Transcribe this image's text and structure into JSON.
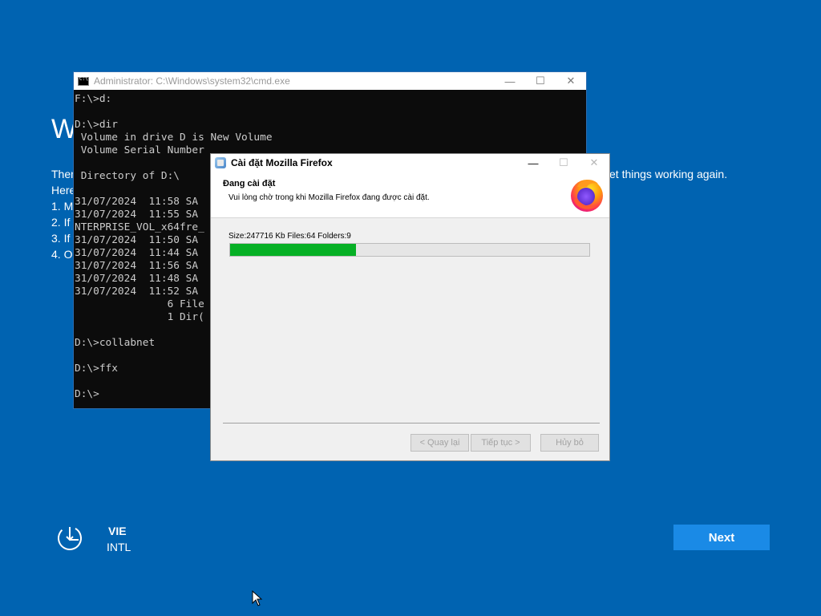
{
  "background": {
    "title": "W",
    "lines": [
      "Then",
      "Here",
      "1. M",
      "2. If",
      "3. If",
      "4. O"
    ],
    "right_text": "et things working again."
  },
  "cmd": {
    "title": "Administrator: C:\\Windows\\system32\\cmd.exe",
    "lines": [
      "F:\\>d:",
      "",
      "D:\\>dir",
      " Volume in drive D is New Volume",
      " Volume Serial Number",
      "",
      " Directory of D:\\",
      "",
      "31/07/2024  11:58 SA",
      "31/07/2024  11:55 SA",
      "NTERPRISE_VOL_x64fre_",
      "31/07/2024  11:50 SA",
      "31/07/2024  11:44 SA",
      "31/07/2024  11:56 SA",
      "31/07/2024  11:48 SA",
      "31/07/2024  11:52 SA",
      "               6 File",
      "               1 Dir(",
      "",
      "D:\\>collabnet",
      "",
      "D:\\>ffx",
      "",
      "D:\\>"
    ]
  },
  "installer": {
    "title": "Cài đặt Mozilla Firefox",
    "heading": "Đang cài đặt",
    "subheading": "Vui lòng chờ trong khi Mozilla Firefox đang được cài đặt.",
    "status": "Size:247716 Kb  Files:64  Folders:9",
    "progress": 0.35,
    "buttons": {
      "back": "< Quay lại",
      "next": "Tiếp tục >",
      "cancel": "Hủy bỏ"
    }
  },
  "language": {
    "code": "VIE",
    "layout": "INTL"
  },
  "next_button": "Next",
  "colors": {
    "background": "#0063b1",
    "progress": "#06b025",
    "next": "#1a8ae6"
  }
}
